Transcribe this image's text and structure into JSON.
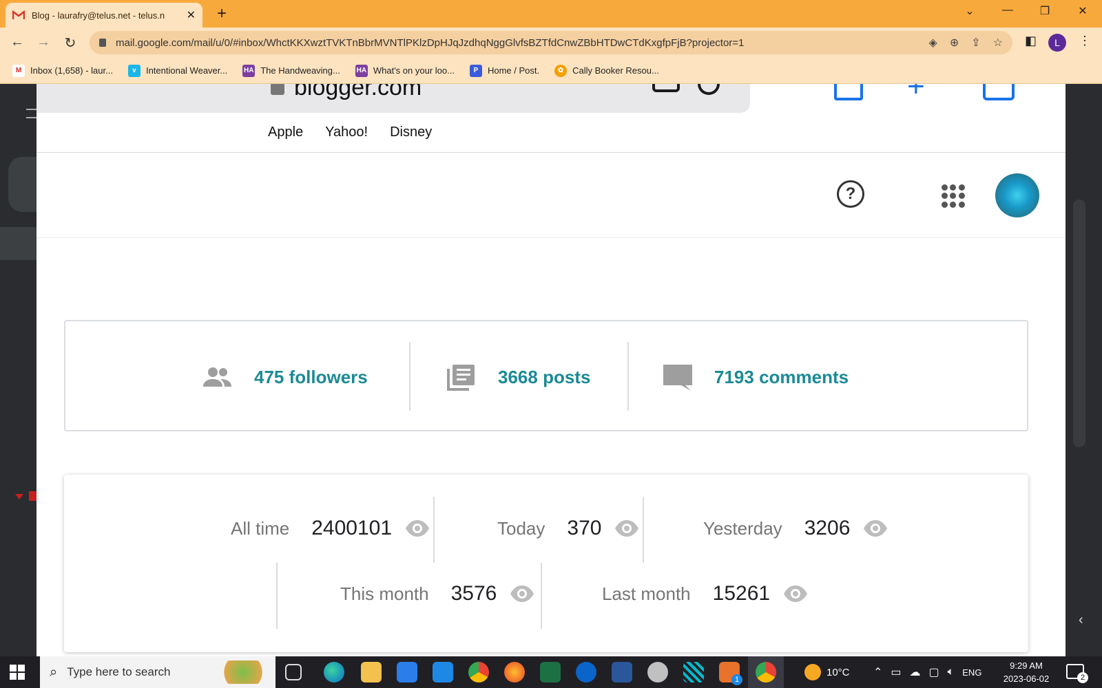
{
  "browser": {
    "tab_title": "Blog - laurafry@telus.net - telus.n",
    "url": "mail.google.com/mail/u/0/#inbox/WhctKKXwztTVKTnBbrMVNTlPKlzDpHJqJzdhqNggGlvfsBZTfdCnwZBbHTDwCTdKxgfpFjB?projector=1",
    "profile_initial": "L",
    "bookmarks": [
      {
        "label": "Inbox (1,658) - laur...",
        "icon": "gmail-icon",
        "color": "#d93025"
      },
      {
        "label": "Intentional Weaver...",
        "icon": "vimeo-icon",
        "color": "#1ab7ea"
      },
      {
        "label": "The Handweaving...",
        "icon": "ha-icon",
        "color": "#7b3fa0"
      },
      {
        "label": "What's on your loo...",
        "icon": "ha-icon",
        "color": "#7b3fa0"
      },
      {
        "label": "Home / Post.",
        "icon": "post-icon",
        "color": "#3b5bdb"
      },
      {
        "label": "Cally Booker Resou...",
        "icon": "flower-icon",
        "color": "#f59f00"
      }
    ]
  },
  "screenshot": {
    "address": "blogger.com",
    "favorites": [
      "Apple",
      "Yahoo!",
      "Disney"
    ],
    "stats": {
      "followers": "475 followers",
      "posts": "3668 posts",
      "comments": "7193 comments"
    },
    "views": [
      {
        "label": "All time",
        "value": "2400101"
      },
      {
        "label": "Today",
        "value": "370"
      },
      {
        "label": "Yesterday",
        "value": "3206"
      },
      {
        "label": "This month",
        "value": "3576"
      },
      {
        "label": "Last month",
        "value": "15261"
      }
    ],
    "accent_color": "#1b8a96"
  },
  "taskbar": {
    "search_placeholder": "Type here to search",
    "weather": "10°C",
    "language": "ENG",
    "time": "9:29 AM",
    "date": "2023-06-02",
    "notifications": "2",
    "badge": "1"
  }
}
